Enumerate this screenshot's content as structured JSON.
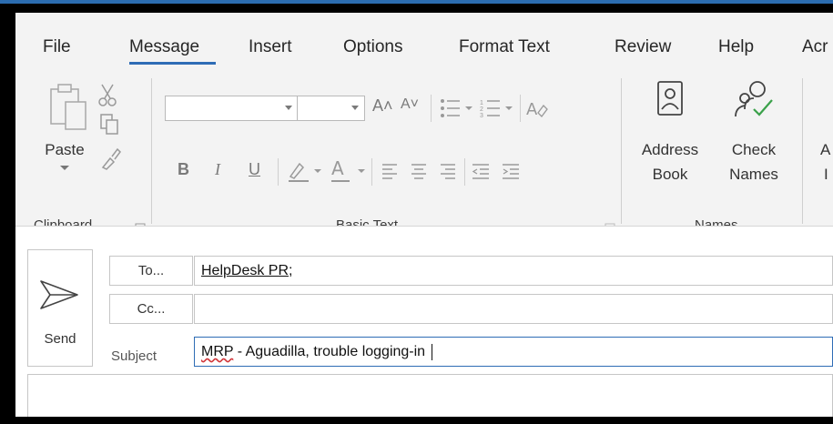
{
  "tabs": [
    {
      "label": "File"
    },
    {
      "label": "Message"
    },
    {
      "label": "Insert"
    },
    {
      "label": "Options"
    },
    {
      "label": "Format Text"
    },
    {
      "label": "Review"
    },
    {
      "label": "Help"
    },
    {
      "label": "Acr"
    }
  ],
  "ribbon": {
    "clipboard": {
      "paste_label": "Paste",
      "group_label": "Clipboard"
    },
    "basic_text": {
      "group_label": "Basic Text",
      "font_name": "",
      "font_size": ""
    },
    "names": {
      "address_book_line1": "Address",
      "address_book_line2": "Book",
      "check_names_line1": "Check",
      "check_names_line2": "Names",
      "group_label": "Names",
      "next_partial_line1": "A",
      "next_partial_line2": "I"
    }
  },
  "compose": {
    "send_label": "Send",
    "to_button": "To...",
    "cc_button": "Cc...",
    "to_value": "HelpDesk PR;",
    "to_recipient": "HelpDesk PR",
    "cc_value": "",
    "subject_label": "Subject",
    "subject_word_flagged": "MRP",
    "subject_rest": " - Aguadilla, trouble logging-in "
  },
  "colors": {
    "accent": "#2e6cb5",
    "check_green": "#3aa14a",
    "spell_red": "#d13438"
  }
}
